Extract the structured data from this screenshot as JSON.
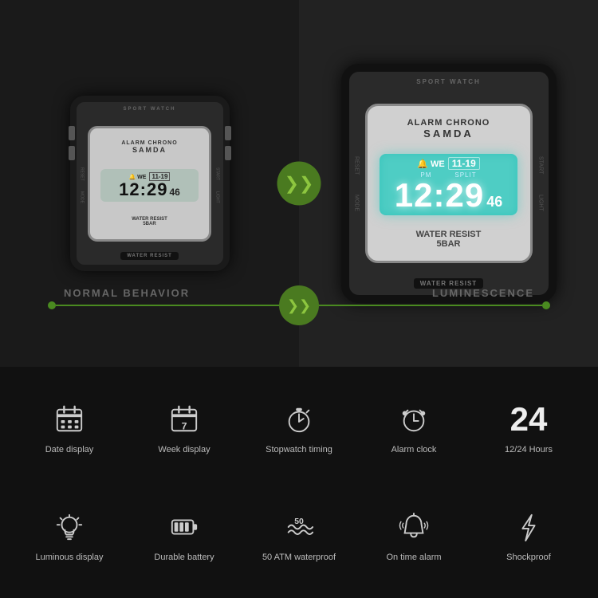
{
  "watch": {
    "brand": "SANDA",
    "series": "ALARM CHRONO",
    "sport": "SPORT WATCH",
    "time_top": "WE  11:19",
    "time_main": "12:29",
    "time_sec": "46",
    "pm": "PM",
    "split": "SPLIT",
    "water_resist": "WATER RESIST",
    "five_bar": "5BAR",
    "bottom_label": "WATER RESIST"
  },
  "labels": {
    "normal": "NORMAL BEHAVIOR",
    "luminescence": "LUMINESCENCE",
    "arrow_symbol": "»»"
  },
  "features": [
    {
      "id": "date-display",
      "icon": "calendar",
      "label": "Date display"
    },
    {
      "id": "week-display",
      "icon": "calendar-week",
      "label": "Week display"
    },
    {
      "id": "stopwatch",
      "icon": "stopwatch",
      "label": "Stopwatch timing"
    },
    {
      "id": "alarm-clock",
      "icon": "alarm",
      "label": "Alarm clock"
    },
    {
      "id": "hours-24",
      "icon": "24",
      "label": "12/24 Hours"
    },
    {
      "id": "luminous",
      "icon": "bulb",
      "label": "Luminous display"
    },
    {
      "id": "battery",
      "icon": "battery",
      "label": "Durable battery"
    },
    {
      "id": "waterproof",
      "icon": "water",
      "label": "50 ATM waterproof"
    },
    {
      "id": "on-time-alarm",
      "icon": "bell",
      "label": "On time alarm"
    },
    {
      "id": "shockproof",
      "icon": "lightning",
      "label": "Shockproof"
    }
  ]
}
